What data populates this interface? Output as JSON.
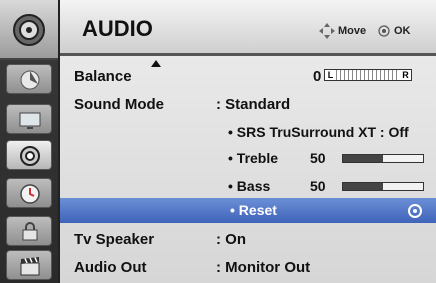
{
  "header": {
    "title": "AUDIO",
    "move_hint": "Move",
    "ok_hint": "OK"
  },
  "sidebar": {
    "items": [
      {
        "icon": "picture-icon"
      },
      {
        "icon": "audio-icon",
        "selected": true
      },
      {
        "icon": "time-icon"
      },
      {
        "icon": "lock-icon"
      },
      {
        "icon": "input-icon"
      }
    ]
  },
  "menu": {
    "balance": {
      "label": "Balance",
      "value": "0",
      "left_mark": "L",
      "right_mark": "R"
    },
    "sound_mode": {
      "label": "Sound Mode",
      "value": ": Standard"
    },
    "srs": {
      "label": "• SRS TruSurround XT : Off"
    },
    "treble": {
      "label": "• Treble",
      "value": "50",
      "level": 0.5
    },
    "bass": {
      "label": "• Bass",
      "value": "50",
      "level": 0.5
    },
    "reset": {
      "label": "• Reset"
    },
    "tv_speaker": {
      "label": "Tv Speaker",
      "value": ": On"
    },
    "audio_out": {
      "label": "Audio Out",
      "value": ": Monitor Out"
    }
  },
  "colors": {
    "highlight": "#4f72c6",
    "panel": "#e2e2e2"
  }
}
